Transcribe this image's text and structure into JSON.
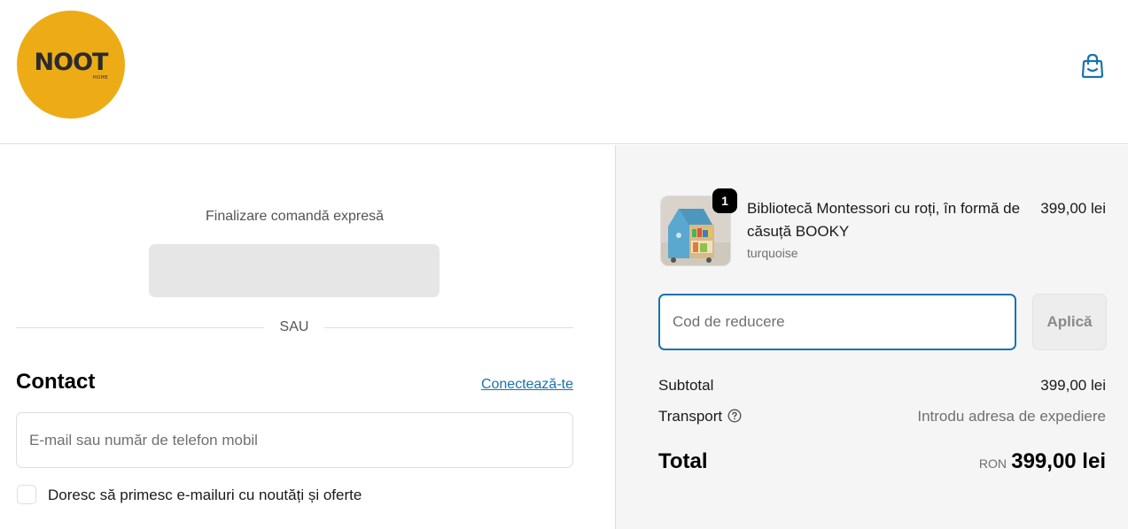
{
  "logo": {
    "word": "NOOT",
    "sub": "HOME",
    "color": "#edab16"
  },
  "header": {
    "cart_icon": "shopping-bag-icon"
  },
  "express": {
    "title": "Finalizare comandă expresă"
  },
  "divider": {
    "label": "SAU"
  },
  "contact": {
    "heading": "Contact",
    "login_link": "Conectează-te",
    "email_placeholder": "E-mail sau număr de telefon mobil",
    "newsletter_label": "Doresc să primesc e-mailuri cu noutăți și oferte"
  },
  "order": {
    "product": {
      "name": "Bibliotecă Montessori cu roți, în formă de căsuță BOOKY",
      "variant": "turquoise",
      "price": "399,00 lei",
      "quantity": "1"
    },
    "discount": {
      "placeholder": "Cod de reducere",
      "apply_label": "Aplică"
    },
    "subtotal": {
      "label": "Subtotal",
      "value": "399,00 lei"
    },
    "shipping": {
      "label": "Transport",
      "value": "Introdu adresa de expediere"
    },
    "total": {
      "label": "Total",
      "currency": "RON",
      "value": "399,00 lei"
    }
  },
  "colors": {
    "accent": "#1773b0",
    "sidebar_bg": "#f5f5f5"
  }
}
